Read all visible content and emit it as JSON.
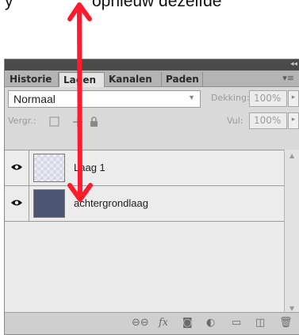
{
  "caption": {
    "left_fragment": "y",
    "right_fragment": "opnieuw dezelfde"
  },
  "panel": {
    "tabs": [
      {
        "label": "Historie"
      },
      {
        "label": "Lagen"
      },
      {
        "label": "Kanalen"
      },
      {
        "label": "Paden"
      }
    ],
    "active_tab": "Lagen",
    "blend_mode": "Normaal",
    "opacity_label": "Dekking:",
    "opacity_value": "100%",
    "lock_label": "Vergr.:",
    "fill_label": "Vul:",
    "fill_value": "100%"
  },
  "layers": [
    {
      "name": "Laag 1",
      "visible": true,
      "thumbnail": "transparent"
    },
    {
      "name": "achtergrondlaag",
      "visible": true,
      "thumbnail": "solid"
    }
  ],
  "footer_icons": [
    "link-icon",
    "fx-icon",
    "mask-icon",
    "adjustment-icon",
    "folder-icon",
    "new-layer-icon",
    "trash-icon"
  ],
  "colors": {
    "annotation_arrow": "#ff1a2e",
    "background_layer_thumb": "#4c5571"
  }
}
